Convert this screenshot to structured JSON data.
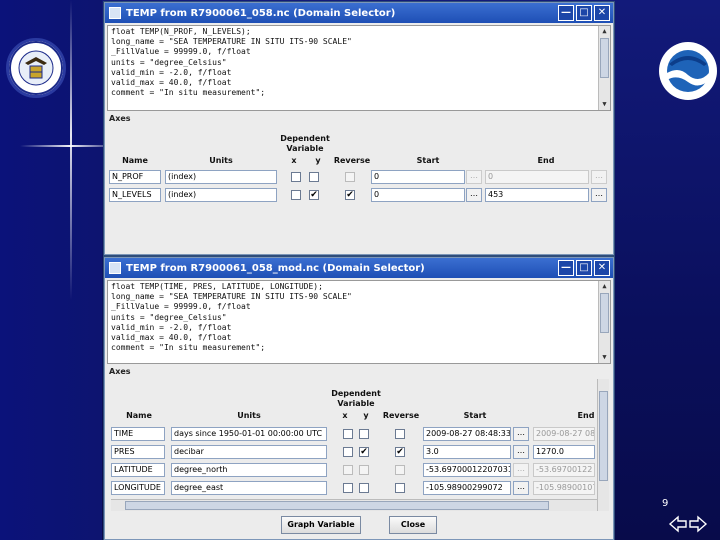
{
  "slide": {
    "page_number": "9"
  },
  "window1": {
    "title": "TEMP from R7900061_058.nc (Domain Selector)",
    "metadata_lines": [
      "float TEMP(N_PROF, N_LEVELS);",
      "  long_name = \"SEA TEMPERATURE IN SITU ITS-90 SCALE\"",
      "  _FillValue = 99999.0, f/float",
      "  units = \"degree_Celsius\"",
      "  valid_min = -2.0, f/float",
      "  valid_max = 40.0, f/float",
      "  comment = \"In situ measurement\";"
    ],
    "axes_label": "Axes",
    "headers": {
      "dependent_variable": "Dependent Variable",
      "name": "Name",
      "units": "Units",
      "x": "x",
      "y": "y",
      "reverse": "Reverse",
      "start": "Start",
      "end": "End"
    },
    "rows": [
      {
        "name": "N_PROF",
        "units": "(index)",
        "x": false,
        "y": false,
        "reverse": false,
        "start": "0",
        "end": "0"
      },
      {
        "name": "N_LEVELS",
        "units": "(index)",
        "x": false,
        "y": true,
        "reverse": true,
        "start": "0",
        "end": "453"
      }
    ],
    "dots": "…"
  },
  "window2": {
    "title": "TEMP from R7900061_058_mod.nc (Domain Selector)",
    "metadata_lines": [
      "float TEMP(TIME, PRES, LATITUDE, LONGITUDE);",
      "  long_name = \"SEA TEMPERATURE IN SITU ITS-90 SCALE\"",
      "  _FillValue = 99999.0, f/float",
      "  units = \"degree_Celsius\"",
      "  valid_min = -2.0, f/float",
      "  valid_max = 40.0, f/float",
      "  comment = \"In situ measurement\";"
    ],
    "axes_label": "Axes",
    "headers": {
      "dependent_variable": "Dependent Variable",
      "name": "Name",
      "units": "Units",
      "x": "x",
      "y": "y",
      "reverse": "Reverse",
      "start": "Start",
      "end": "End"
    },
    "rows": [
      {
        "name": "TIME",
        "units": "days since 1950-01-01 00:00:00 UTC",
        "x": false,
        "y": false,
        "reverse": false,
        "start": "2009-08-27 08:48:33",
        "end": "2009-08-27 08"
      },
      {
        "name": "PRES",
        "units": "decibar",
        "x": false,
        "y": true,
        "reverse": true,
        "start": "3.0",
        "end": "1270.0"
      },
      {
        "name": "LATITUDE",
        "units": "degree_north",
        "x": false,
        "y": false,
        "reverse": false,
        "start": "-53.69700012207031",
        "end": "-53.69700122"
      },
      {
        "name": "LONGITUDE",
        "units": "degree_east",
        "x": false,
        "y": false,
        "reverse": false,
        "start": "-105.98900299072",
        "end": "-105.989001071"
      }
    ],
    "dots": "…",
    "graph_button": "Graph Variable",
    "close_button": "Close"
  }
}
